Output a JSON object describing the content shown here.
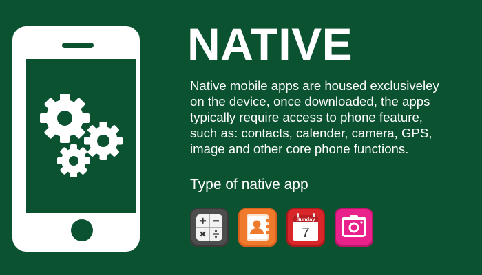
{
  "title": "NATIVE",
  "description": [
    "Native mobile apps are housed exclusiveley",
    "on the device, once downloaded, the apps",
    "typically require access to phone feature,",
    "such as: contacts, calender, camera, GPS,",
    "image and other core phone functions."
  ],
  "subtitle": "Type of native app",
  "calendar_icon": {
    "day_name": "Sunday",
    "day_number": "7"
  },
  "colors": {
    "background": "#0b5230",
    "foreground": "#ffffff",
    "calculator": "#4a4a4a",
    "contacts": "#f07a2c",
    "calendar": "#d8262b",
    "camera": "#e8218b"
  },
  "icons": [
    "phone-icon",
    "gears-icon",
    "calculator-app-icon",
    "contacts-app-icon",
    "calendar-app-icon",
    "camera-app-icon"
  ]
}
